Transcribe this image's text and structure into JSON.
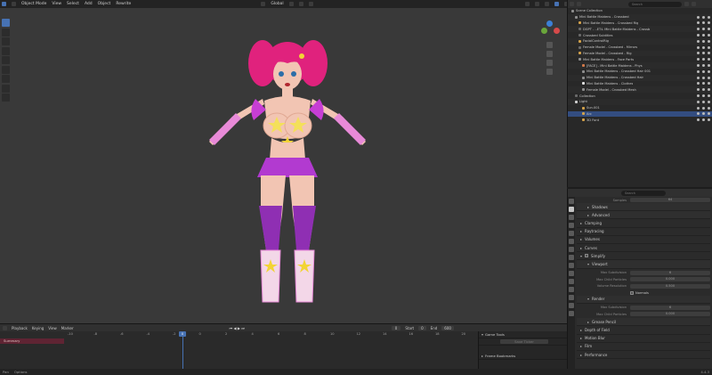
{
  "topbar": {
    "menu": [
      "Object Mode",
      "View",
      "Select",
      "Add",
      "Object",
      "Rewrite"
    ],
    "orientation": "Global",
    "options_label": "Options"
  },
  "viewport": {
    "background": "#393939",
    "figure": {
      "hair_color": "#e0227d",
      "skin_color": "#f2c5b3",
      "top_color": "#f4e05a",
      "skirt_color": "#b23ad0",
      "boots_color": "#8f2fb3",
      "gloves_color": "#e88ad8",
      "star_color": "#f2d435"
    }
  },
  "outliner": {
    "search_placeholder": "Search",
    "rows": [
      {
        "label": "Scene Collection",
        "color": "#8e8e8e"
      },
      {
        "label": "Mini Battle Maidens - Crossbed",
        "color": "#8e8e8e"
      },
      {
        "label": "Mini Battle Maidens - Crossbed Rig",
        "color": "#d4a24a"
      },
      {
        "label": "DGPT - ..ET:L Mini Battle Maidens - Crossb",
        "color": "#6a6a6a"
      },
      {
        "label": "Crossbed Subtitles",
        "color": "#6a6a6a"
      },
      {
        "label": "FacialControlRig",
        "color": "#d4a24a"
      },
      {
        "label": "Female Model - Crossbed - Mirrors",
        "color": "#6a6a6a"
      },
      {
        "label": "Female Model - Crossbed - Rig",
        "color": "#d4a24a"
      },
      {
        "label": "Mini Battle Maidens - Face Parts",
        "color": "#8e8e8e"
      },
      {
        "label": "[FACE] - Mini Battle Maidens - Phys",
        "color": "#d27a4a"
      },
      {
        "label": "Mini Battle Maidens - Crossbed Hair 001",
        "color": "#8e8e8e"
      },
      {
        "label": "Mini Battle Maidens - Crossbed Hair",
        "color": "#8e8e8e"
      },
      {
        "label": "Mini Battle Maidens - Clothes",
        "color": "#e0e0e0"
      },
      {
        "label": "Female Model - Crossbed Mesh",
        "color": "#8e8e8e"
      },
      {
        "label": "Collection",
        "color": "#6a6a6a"
      },
      {
        "label": "Light",
        "color": "#d0d0d0"
      },
      {
        "label": "Sun.001",
        "color": "#d4a24a"
      },
      {
        "label": "Arc",
        "color": "#d4a24a"
      },
      {
        "label": "3D Font",
        "color": "#d4a24a"
      }
    ],
    "selected_index": 17
  },
  "properties": {
    "search_placeholder": "Search",
    "samples_label": "Samples",
    "samples_value": "64",
    "panels": [
      {
        "label": "Shadows",
        "level": 1
      },
      {
        "label": "Advanced",
        "level": 1
      },
      {
        "label": "Clamping",
        "level": 0
      },
      {
        "label": "Raytracing",
        "level": 0
      },
      {
        "label": "Volumes",
        "level": 0
      },
      {
        "label": "Curves",
        "level": 0
      },
      {
        "label": "Simplify",
        "level": 0
      }
    ],
    "viewport_section": "Viewport",
    "viewport_fields": [
      {
        "label": "Max Subdivision",
        "value": "6"
      },
      {
        "label": "Max Child Particles",
        "value": "0.000"
      },
      {
        "label": "Volume Resolution",
        "value": "0.500"
      }
    ],
    "normals_label": "Normals",
    "render_section": "Render",
    "render_fields": [
      {
        "label": "Max Subdivision",
        "value": "6"
      },
      {
        "label": "Max Child Particles",
        "value": "0.000"
      }
    ],
    "grease_pencil": "Grease Pencil",
    "bottom_panels": [
      "Depth of Field",
      "Motion Blur",
      "Film",
      "Performance"
    ]
  },
  "timeline": {
    "menu": [
      "Playback",
      "Keying",
      "View",
      "Marker"
    ],
    "current_frame": "0",
    "start_label": "Start",
    "start_value": "0",
    "end_label": "End",
    "end_value": "600",
    "frame_numbers": [
      "-10",
      "-8",
      "-6",
      "-4",
      "-2",
      "0",
      "2",
      "4",
      "6",
      "8",
      "10",
      "12",
      "14",
      "16",
      "18",
      "20"
    ],
    "summary_label": "Summary",
    "side_panels": [
      "Game Tools",
      "Frame Bookmarks"
    ],
    "side_button": "Save Ticker"
  },
  "statusbar": {
    "left": [
      "Pan",
      "Options"
    ],
    "version": "4.4.3"
  }
}
